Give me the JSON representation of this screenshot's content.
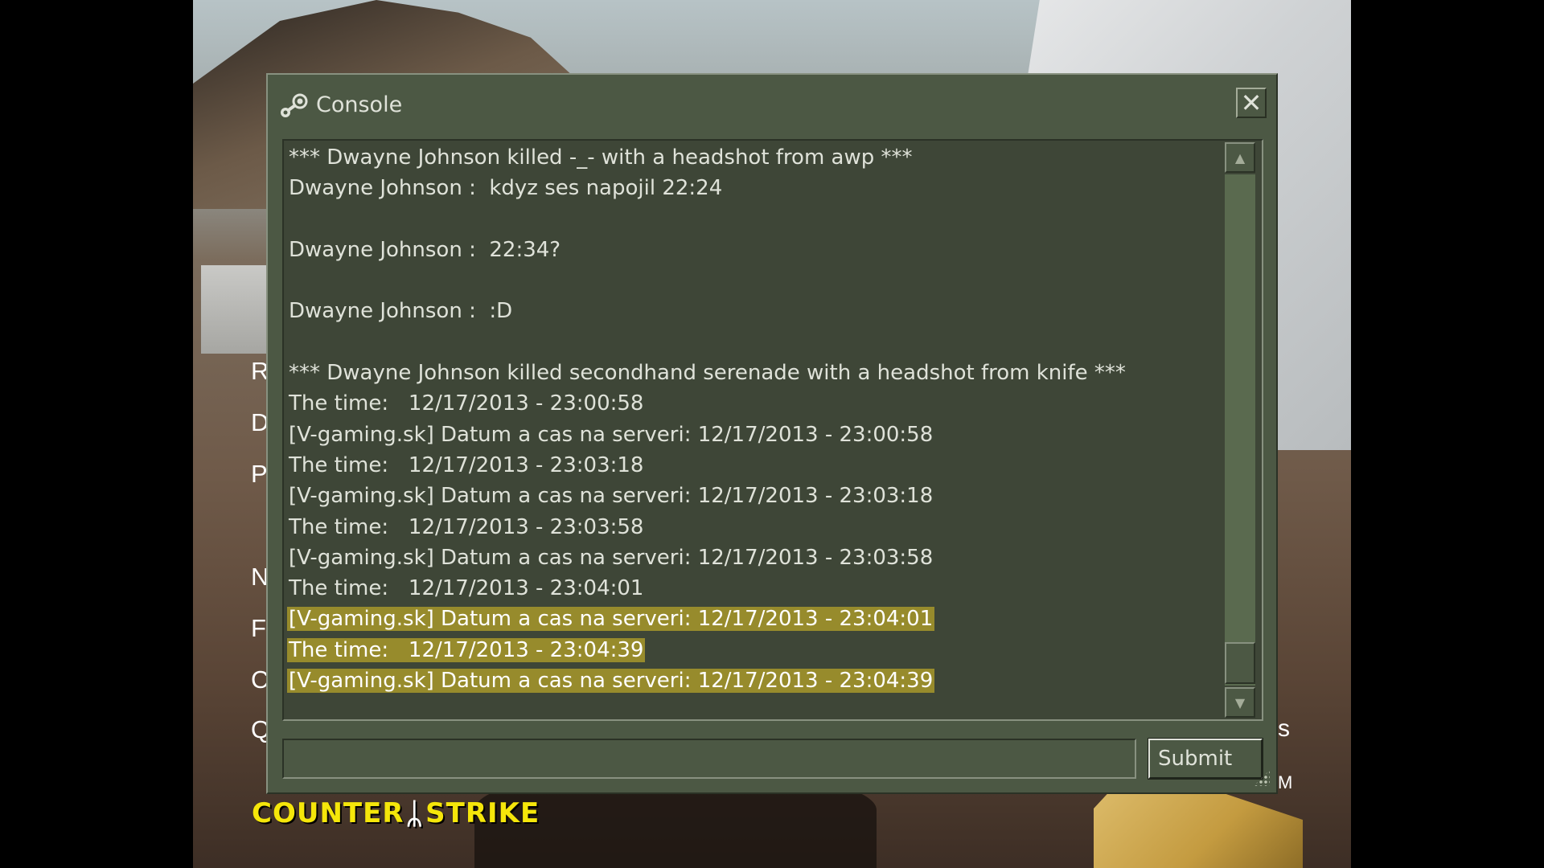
{
  "background": {
    "menu_letters_left": [
      "R",
      "D",
      "P",
      "N",
      "F",
      "C",
      "Q"
    ],
    "menu_letters_right": [
      "s",
      "M"
    ],
    "logo": {
      "left": "Counter",
      "right": "Strike"
    }
  },
  "console": {
    "title": "Console",
    "title_icon": "steam-icon",
    "close_icon": "close-icon",
    "lines": [
      {
        "text": "*** Dwayne Johnson killed -_- with a headshot from awp ***",
        "highlighted": false
      },
      {
        "text": "Dwayne Johnson :  kdyz ses napojil 22:24",
        "highlighted": false
      },
      {
        "text": "",
        "highlighted": false
      },
      {
        "text": "Dwayne Johnson :  22:34?",
        "highlighted": false
      },
      {
        "text": "",
        "highlighted": false
      },
      {
        "text": "Dwayne Johnson :  :D",
        "highlighted": false
      },
      {
        "text": "",
        "highlighted": false
      },
      {
        "text": "*** Dwayne Johnson killed secondhand serenade with a headshot from knife ***",
        "highlighted": false
      },
      {
        "text": "The time:   12/17/2013 - 23:00:58",
        "highlighted": false
      },
      {
        "text": "[V-gaming.sk] Datum a cas na serveri: 12/17/2013 - 23:00:58",
        "highlighted": false
      },
      {
        "text": "The time:   12/17/2013 - 23:03:18",
        "highlighted": false
      },
      {
        "text": "[V-gaming.sk] Datum a cas na serveri: 12/17/2013 - 23:03:18",
        "highlighted": false
      },
      {
        "text": "The time:   12/17/2013 - 23:03:58",
        "highlighted": false
      },
      {
        "text": "[V-gaming.sk] Datum a cas na serveri: 12/17/2013 - 23:03:58",
        "highlighted": false
      },
      {
        "text": "The time:   12/17/2013 - 23:04:01",
        "highlighted": false
      },
      {
        "text": "[V-gaming.sk] Datum a cas na serveri: 12/17/2013 - 23:04:01",
        "highlighted": true
      },
      {
        "text": "The time:   12/17/2013 - 23:04:39",
        "highlighted": true
      },
      {
        "text": "[V-gaming.sk] Datum a cas na serveri: 12/17/2013 - 23:04:39",
        "highlighted": true
      }
    ],
    "input": {
      "value": "",
      "placeholder": ""
    },
    "submit_label": "Submit",
    "scroll_up_icon": "arrow-up-icon",
    "scroll_down_icon": "arrow-down-icon"
  },
  "colors": {
    "panel": "#4c5844",
    "output_bg": "#3e4637",
    "text": "#dfe2d9",
    "highlight": "#978b2c",
    "logo": "#f5e60a"
  }
}
